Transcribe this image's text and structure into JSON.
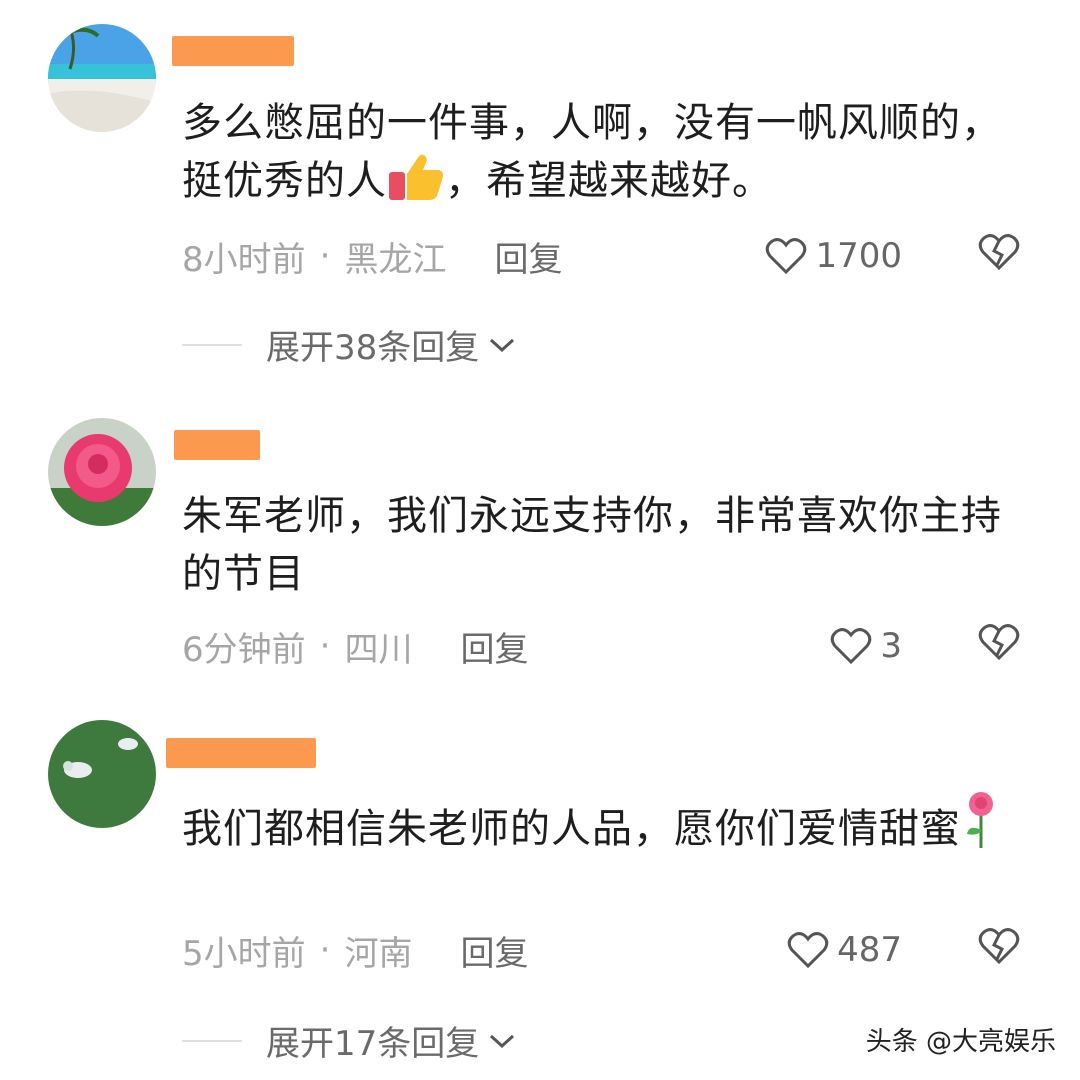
{
  "comments": [
    {
      "text_part1": "多么憋屈的一件事，人啊，没有一帆风顺的，挺优秀的人",
      "text_part2": "，希望越来越好。",
      "emoji": "thumbs-up-icon",
      "time": "8小时前",
      "separator": "·",
      "location": "黑龙江",
      "reply": "回复",
      "likes": "1700",
      "expand": "展开38条回复"
    },
    {
      "text_part1": "朱军老师，我们永远支持你，非常喜欢你主持的节目",
      "time": "6分钟前",
      "separator": "·",
      "location": "四川",
      "reply": "回复",
      "likes": "3"
    },
    {
      "text_part1": "我们都相信朱老师的人品，愿你们爱情甜蜜",
      "emoji": "rose-icon",
      "time": "5小时前",
      "separator": "·",
      "location": "河南",
      "reply": "回复",
      "likes": "487",
      "expand": "展开17条回复"
    }
  ],
  "watermark": "头条 @大亮娱乐",
  "colors": {
    "username_mask": "#fb9a4f",
    "secondary_text": "#a6a6a6",
    "body_text": "#1e1e1e"
  }
}
